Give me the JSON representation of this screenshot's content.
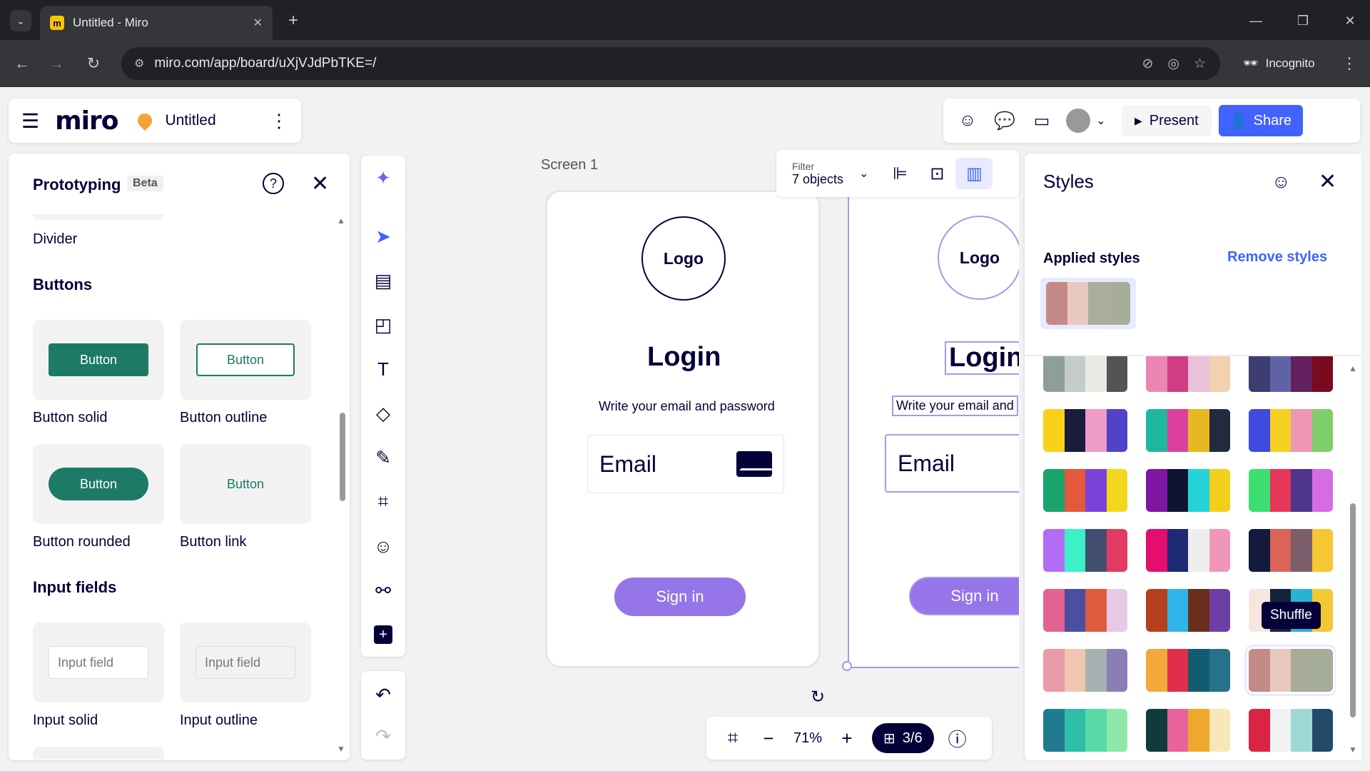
{
  "browser": {
    "tab_title": "Untitled - Miro",
    "url": "miro.com/app/board/uXjVJdPbTKE=/",
    "incognito_label": "Incognito"
  },
  "board": {
    "logo": "miro",
    "name": "Untitled"
  },
  "topbar": {
    "present_label": "Present",
    "share_label": "Share"
  },
  "prototyping": {
    "title": "Prototyping",
    "badge": "Beta",
    "divider_label": "Divider",
    "buttons_heading": "Buttons",
    "buttons": [
      {
        "preview": "Button",
        "label": "Button solid"
      },
      {
        "preview": "Button",
        "label": "Button outline"
      },
      {
        "preview": "Button",
        "label": "Button rounded"
      },
      {
        "preview": "Button",
        "label": "Button link"
      }
    ],
    "inputs_heading": "Input fields",
    "inputs": [
      {
        "preview": "Input field",
        "label": "Input solid"
      },
      {
        "preview": "Input field",
        "label": "Input outline"
      }
    ]
  },
  "canvas": {
    "frame_label": "Screen 1",
    "screen": {
      "logo": "Logo",
      "title": "Login",
      "subtitle": "Write your email and password",
      "email_placeholder": "Email",
      "signin": "Sign in"
    },
    "screen2": {
      "logo": "Logo",
      "title": "Login",
      "subtitle": "Write your email and",
      "email_placeholder": "Email",
      "signin": "Sign in"
    }
  },
  "context_toolbar": {
    "filter_label": "Filter",
    "filter_value": "7 objects"
  },
  "styles_panel": {
    "title": "Styles",
    "applied_label": "Applied styles",
    "remove_label": "Remove styles",
    "applied_colors": [
      "#c48b86",
      "#e9c9bd",
      "#a9ad9a",
      "#a7ad98"
    ],
    "palettes": [
      [
        "#8e9e9a",
        "#c3ccc9",
        "#eae9e4",
        "#545456"
      ],
      [
        "#ea86b4",
        "#d23c85",
        "#e9c1d9",
        "#f2d1b0"
      ],
      [
        "#3e3d72",
        "#5f63a6",
        "#62205f",
        "#7a0b1e"
      ],
      [
        "#f8d21a",
        "#1a1c3b",
        "#ef9bc8",
        "#5143c9"
      ],
      [
        "#1fb89e",
        "#db3f9f",
        "#e8b820",
        "#202b3f"
      ],
      [
        "#3f4be0",
        "#f5d023",
        "#ee97b6",
        "#7ecf6a"
      ],
      [
        "#1aa36b",
        "#e4593b",
        "#7a43d7",
        "#f2d81d"
      ],
      [
        "#7e16a2",
        "#0f1431",
        "#23d3d8",
        "#f2cf1a"
      ],
      [
        "#3fde73",
        "#e6365a",
        "#50358c",
        "#d56ce6"
      ],
      [
        "#b36cf5",
        "#3cf0c8",
        "#424e70",
        "#e23b62"
      ],
      [
        "#e50d6e",
        "#1f2a77",
        "#eeeeee",
        "#f097b9"
      ],
      [
        "#131a3b",
        "#d96457",
        "#7a5f6a",
        "#f6c634"
      ],
      [
        "#e36292",
        "#4a4fa0",
        "#e05a3d",
        "#e7c9e5"
      ],
      [
        "#b6401e",
        "#2fb4e9",
        "#6a2f1c",
        "#6d3fa6"
      ],
      [
        "#f7e6e0",
        "#14233b",
        "#29b3d3",
        "#f2c935"
      ],
      [
        "#e99ba7",
        "#f0c6b0",
        "#a6b1b1",
        "#8c7eb4"
      ],
      [
        "#f2a93b",
        "#e02e4b",
        "#125c70",
        "#25728a"
      ],
      [
        "#c38b86",
        "#e8c8bc",
        "#a8ac99",
        "#a6ad98"
      ],
      [
        "#217b8f",
        "#2fbea7",
        "#59d9a8",
        "#8de8a8"
      ],
      [
        "#0f3b3f",
        "#e9629a",
        "#f0a72e",
        "#f7e7b9"
      ],
      [
        "#d92442",
        "#f1f2f2",
        "#9ed8d6",
        "#244a6b"
      ]
    ],
    "tooltip": "Shuffle"
  },
  "zoom": {
    "value": "71%",
    "pages": "3/6"
  }
}
